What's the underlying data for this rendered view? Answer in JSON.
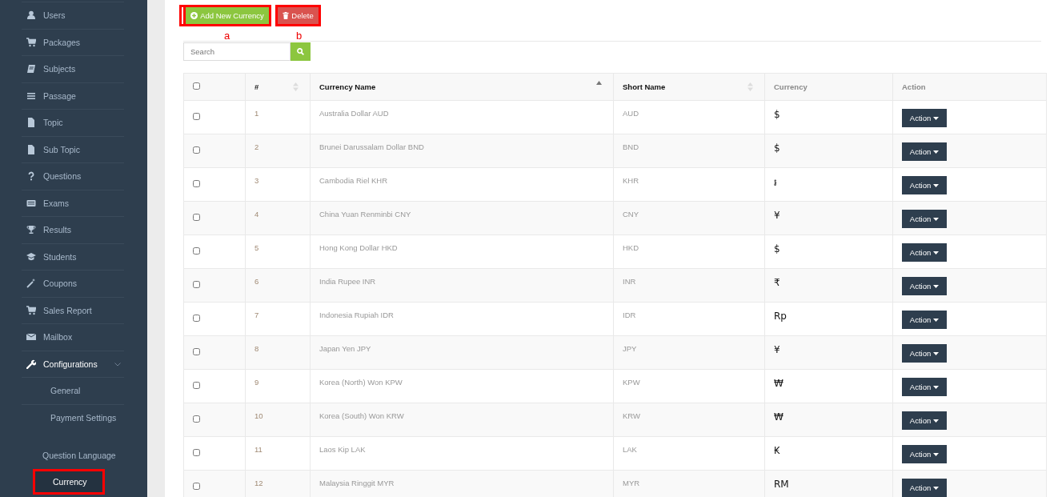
{
  "sidebar": {
    "items": [
      {
        "label": "Users",
        "selected": false
      },
      {
        "label": "Packages",
        "selected": false
      },
      {
        "label": "Subjects",
        "selected": false
      },
      {
        "label": "Passage",
        "selected": false
      },
      {
        "label": "Topic",
        "selected": false
      },
      {
        "label": "Sub Topic",
        "selected": false
      },
      {
        "label": "Questions",
        "selected": false
      },
      {
        "label": "Exams",
        "selected": false
      },
      {
        "label": "Results",
        "selected": false
      },
      {
        "label": "Students",
        "selected": false
      },
      {
        "label": "Coupons",
        "selected": false
      },
      {
        "label": "Sales Report",
        "selected": false
      },
      {
        "label": "Mailbox",
        "selected": false
      },
      {
        "label": "Configurations",
        "selected": false,
        "expanded": true,
        "children": [
          {
            "label": "General",
            "selected": false
          },
          {
            "label": "Payment Settings",
            "selected": false
          }
        ]
      },
      {
        "label": "Question Language",
        "selected": false
      },
      {
        "label": "Currency",
        "selected": true,
        "annotated": true
      }
    ]
  },
  "toolbar": {
    "buttons": [
      {
        "label": "Add New Currency",
        "kind": "add",
        "annotated": true,
        "annotation": "a"
      },
      {
        "label": "Delete",
        "kind": "delete",
        "annotated": true,
        "annotation": "b"
      }
    ]
  },
  "search": {
    "placeholder": "Search"
  },
  "table": {
    "select_all_checked": false,
    "columns": [
      {
        "label": "#",
        "sortable": true,
        "sorted": false
      },
      {
        "label": "Currency Name",
        "sortable": true,
        "sorted": true
      },
      {
        "label": "Short Name",
        "sortable": true,
        "sorted": false
      },
      {
        "label": "Currency",
        "sortable": false,
        "sorted": false
      },
      {
        "label": "Action",
        "sortable": false,
        "sorted": false
      }
    ],
    "rows": [
      {
        "checked": false,
        "number": "1",
        "name": "Australia Dollar AUD",
        "short": "AUD",
        "symbol": "$",
        "action": "Action"
      },
      {
        "checked": false,
        "number": "2",
        "name": "Brunei Darussalam Dollar BND",
        "short": "BND",
        "symbol": "$",
        "action": "Action"
      },
      {
        "checked": false,
        "number": "3",
        "name": "Cambodia Riel KHR",
        "short": "KHR",
        "symbol": "៛",
        "action": "Action"
      },
      {
        "checked": false,
        "number": "4",
        "name": "China Yuan Renminbi CNY",
        "short": "CNY",
        "symbol": "¥",
        "action": "Action"
      },
      {
        "checked": false,
        "number": "5",
        "name": "Hong Kong Dollar HKD",
        "short": "HKD",
        "symbol": "$",
        "action": "Action"
      },
      {
        "checked": false,
        "number": "6",
        "name": "India Rupee INR",
        "short": "INR",
        "symbol": "₹",
        "action": "Action"
      },
      {
        "checked": false,
        "number": "7",
        "name": "Indonesia Rupiah IDR",
        "short": "IDR",
        "symbol": "Rp",
        "action": "Action"
      },
      {
        "checked": false,
        "number": "8",
        "name": "Japan Yen JPY",
        "short": "JPY",
        "symbol": "¥",
        "action": "Action"
      },
      {
        "checked": false,
        "number": "9",
        "name": "Korea (North) Won KPW",
        "short": "KPW",
        "symbol": "₩",
        "action": "Action"
      },
      {
        "checked": false,
        "number": "10",
        "name": "Korea (South) Won KRW",
        "short": "KRW",
        "symbol": "₩",
        "action": "Action"
      },
      {
        "checked": false,
        "number": "11",
        "name": "Laos Kip LAK",
        "short": "LAK",
        "symbol": "₭",
        "action": "Action"
      },
      {
        "checked": false,
        "number": "12",
        "name": "Malaysia Ringgit MYR",
        "short": "MYR",
        "symbol": "RM",
        "action": "Action"
      }
    ]
  }
}
